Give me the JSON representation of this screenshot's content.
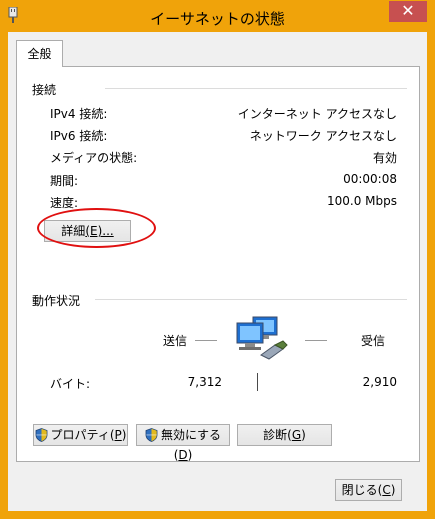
{
  "window": {
    "title": "イーサネットの状態",
    "close_glyph": "✕"
  },
  "tabs": [
    {
      "label": "全般"
    }
  ],
  "connection": {
    "title": "接続",
    "rows": [
      {
        "label": "IPv4 接続:",
        "value": "インターネット アクセスなし"
      },
      {
        "label": "IPv6 接続:",
        "value": "ネットワーク アクセスなし"
      },
      {
        "label": "メディアの状態:",
        "value": "有効"
      },
      {
        "label": "期間:",
        "value": "00:00:08"
      },
      {
        "label": "速度:",
        "value": "100.0 Mbps"
      }
    ],
    "details_button": {
      "text": "詳細",
      "accel": "(E)...",
      "accel_u": "E"
    }
  },
  "activity": {
    "title": "動作状況",
    "sent_label": "送信",
    "received_label": "受信",
    "bytes_label": "バイト:",
    "bytes_sent": "7,312",
    "bytes_received": "2,910",
    "icon": "network-computers-icon"
  },
  "buttons": {
    "properties": {
      "text": "プロパティ",
      "accel": "P"
    },
    "disable": {
      "text": "無効にする",
      "accel": "D"
    },
    "diagnose": {
      "text": "診断",
      "accel": "G"
    },
    "close": {
      "text": "閉じる",
      "accel": "C"
    }
  },
  "colors": {
    "title_bar": "#f0a30a",
    "close_button": "#c75050",
    "highlight_ellipse": "#e01010"
  }
}
